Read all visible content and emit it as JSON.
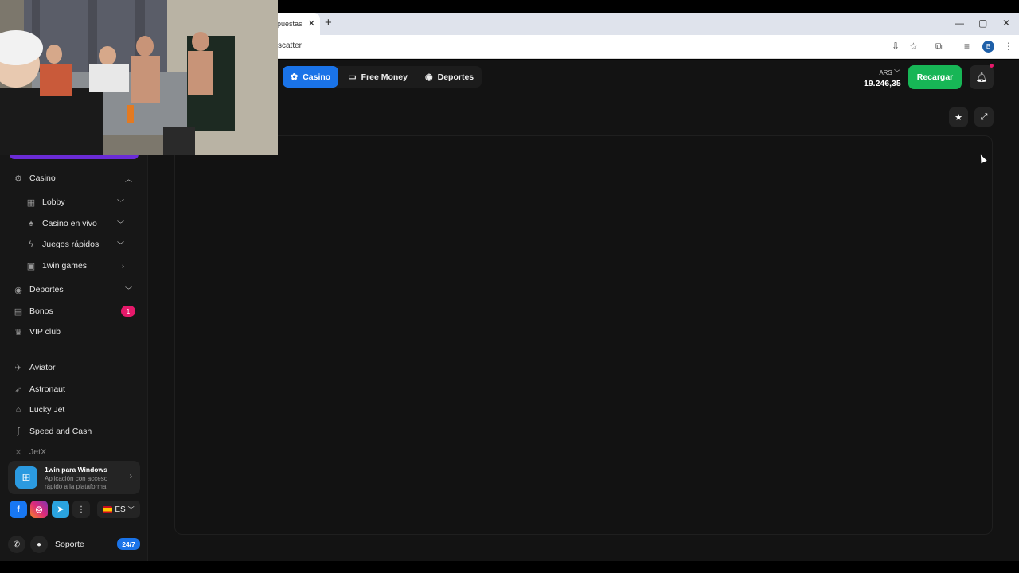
{
  "browser": {
    "tab_title": "puestas",
    "tab_close": "✕",
    "new_tab": "+",
    "url": "scatter",
    "window_controls": [
      "—",
      "▢",
      "✕"
    ],
    "profile_initial": "B"
  },
  "topnav": {
    "tabs": [
      {
        "label": "Casino",
        "icon": "casino-icon",
        "active": true
      },
      {
        "label": "Free Money",
        "icon": "money-icon",
        "active": false
      },
      {
        "label": "Deportes",
        "icon": "ball-icon",
        "active": false
      }
    ],
    "currency": "ARS",
    "balance": "19.246,35",
    "recargar": "Recargar"
  },
  "sidebar": {
    "casino": {
      "label": "Casino",
      "icon": "gear-icon"
    },
    "sub_items": [
      {
        "label": "Lobby",
        "icon": "grid-icon"
      },
      {
        "label": "Casino en vivo",
        "icon": "spade-icon"
      },
      {
        "label": "Juegos rápidos",
        "icon": "bolt-icon"
      },
      {
        "label": "1win games",
        "icon": "badge-icon"
      }
    ],
    "deportes": {
      "label": "Deportes",
      "icon": "ball-icon"
    },
    "bonos": {
      "label": "Bonos",
      "icon": "gift-icon",
      "badge": "1"
    },
    "vip": {
      "label": "VIP club",
      "icon": "crown-icon"
    },
    "games": [
      {
        "label": "Aviator",
        "icon": "plane-icon"
      },
      {
        "label": "Astronaut",
        "icon": "rocket-icon"
      },
      {
        "label": "Lucky Jet",
        "icon": "jet-icon"
      },
      {
        "label": "Speed and Cash",
        "icon": "car-icon"
      },
      {
        "label": "JetX",
        "icon": "x-icon"
      }
    ],
    "windows_card": {
      "title": "1win para Windows",
      "subtitle": "Aplicación con acceso rápido a la plataforma"
    },
    "language": "ES",
    "support": {
      "label": "Soporte",
      "badge": "24/7"
    }
  },
  "colors": {
    "accent_blue": "#1a73e8",
    "recargar_green": "#17b656",
    "badge_pink": "#e6196a",
    "background": "#131313"
  }
}
